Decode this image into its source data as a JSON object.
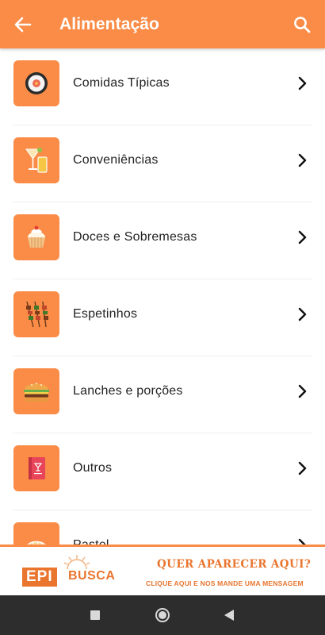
{
  "header": {
    "title": "Alimentação",
    "back_icon": "arrow-left-icon",
    "search_icon": "search-icon",
    "color": "#fa8c47"
  },
  "list": {
    "items": [
      {
        "label": "Comidas Típicas",
        "icon": "sushi-icon"
      },
      {
        "label": "Conveniências",
        "icon": "cocktail-icon"
      },
      {
        "label": "Doces e Sobremesas",
        "icon": "cupcake-icon"
      },
      {
        "label": "Espetinhos",
        "icon": "skewers-icon"
      },
      {
        "label": "Lanches e porções",
        "icon": "burger-icon"
      },
      {
        "label": "Outros",
        "icon": "menu-book-icon"
      },
      {
        "label": "Pastel",
        "icon": "pastry-icon"
      }
    ]
  },
  "banner": {
    "logo_epi": "EPI",
    "logo_busca": "BUSCA",
    "headline": "QUER APARECER AQUI?",
    "subline": "CLIQUE AQUI E NOS MANDE UMA MENSAGEM"
  },
  "system_nav": {
    "recents_icon": "square-icon",
    "home_icon": "circle-icon",
    "back_icon": "triangle-back-icon"
  }
}
